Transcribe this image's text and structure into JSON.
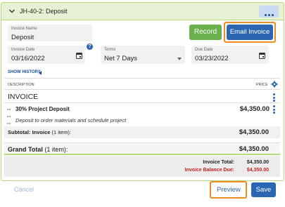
{
  "header": {
    "title": "JH-40-2: Deposit",
    "more_icon": "more-horizontal-icon"
  },
  "invoice_name": {
    "label": "Invoice Name",
    "value": "Deposit"
  },
  "actions": {
    "record_label": "Record",
    "email_label": "Email Invoice"
  },
  "invoice_date": {
    "label": "Invoice Date",
    "value": "03/16/2022"
  },
  "terms": {
    "label": "Terms",
    "value": "Net 7 Days"
  },
  "due_date": {
    "label": "Due Date",
    "value": "03/23/2022"
  },
  "show_history": "SHOW HISTORY",
  "columns": {
    "description": "DESCRIPTION",
    "price": "PRICE"
  },
  "section_title": "INVOICE",
  "item": {
    "title": "30% Project Deposit",
    "price": "$4,350.00",
    "description": "Deposit to order materials and schedule project"
  },
  "subtotal": {
    "label": "Subtotal: Invoice",
    "count": "(1 item):",
    "value": "$4,350.00"
  },
  "grand_total": {
    "label": "Grand Total",
    "count": "(1 item):",
    "value": "$4,350.00"
  },
  "totals": {
    "invoice_total_label": "Invoice Total:",
    "invoice_total_value": "$4,350.00",
    "balance_label": "Invoice Balance Due:",
    "balance_value": "$4,350.00"
  },
  "footer": {
    "cancel_label": "Cancel",
    "preview_label": "Preview",
    "save_label": "Save"
  },
  "colors": {
    "accent": "#2a66b1",
    "record": "#6ab04c",
    "highlight": "#f08a24",
    "header_bg": "#e6f2d3",
    "balance_due": "#cc1f1f"
  }
}
